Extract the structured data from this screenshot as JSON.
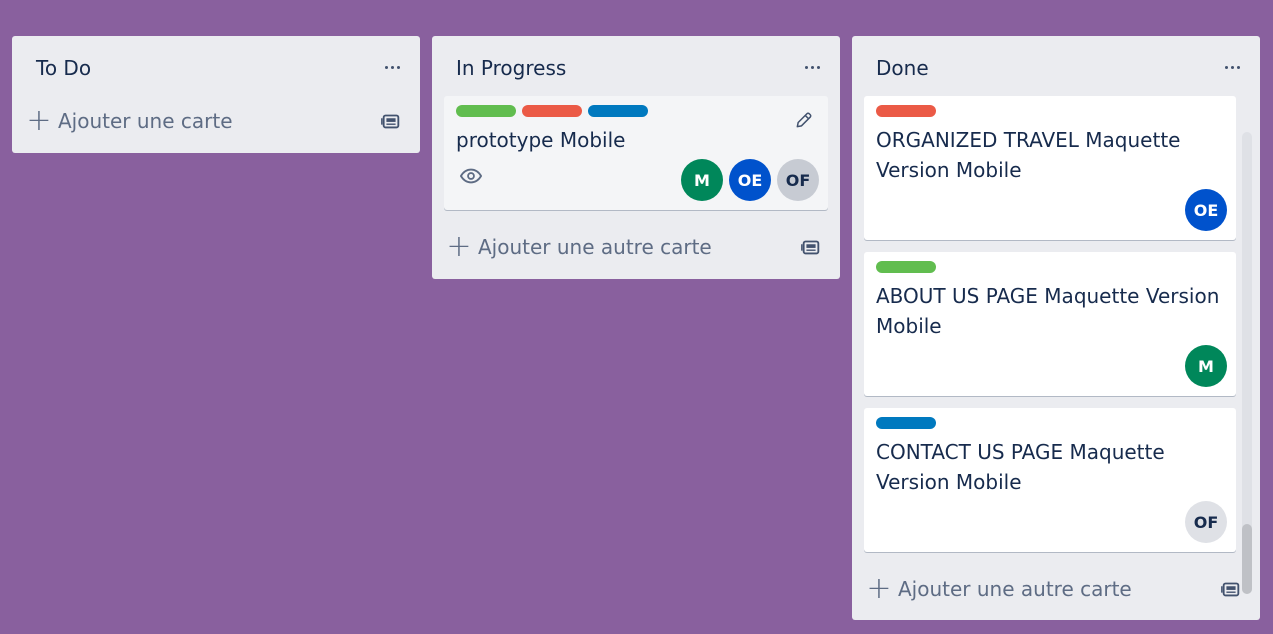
{
  "colors": {
    "board_bg": "#89609e",
    "label_green": "#61bd4f",
    "label_red": "#eb5a46",
    "label_blue": "#0079bf",
    "avatar_m": "#00875a",
    "avatar_oe": "#0052cc",
    "avatar_of": "#dfe1e6"
  },
  "lists": [
    {
      "title": "To Do",
      "add_label": "Ajouter une carte"
    },
    {
      "title": "In Progress",
      "cards": [
        {
          "labels": [
            "green",
            "red",
            "blue"
          ],
          "title": "prototype Mobile",
          "has_watch_icon": true,
          "members": [
            "M",
            "OE",
            "OF"
          ]
        }
      ],
      "add_label": "Ajouter une autre carte"
    },
    {
      "title": "Done",
      "cards": [
        {
          "labels": [
            "red"
          ],
          "title": "ORGANIZED TRAVEL Maquette Version Mobile",
          "members": [
            "OE"
          ]
        },
        {
          "labels": [
            "green"
          ],
          "title": "ABOUT US PAGE Maquette Version Mobile",
          "members": [
            "M"
          ]
        },
        {
          "labels": [
            "blue"
          ],
          "title": "CONTACT US PAGE Maquette Version Mobile",
          "members": [
            "OF"
          ]
        }
      ],
      "add_label": "Ajouter une autre carte"
    }
  ],
  "icons": {
    "list_menu": "more-horizontal-icon",
    "add": "plus-icon",
    "template": "card-template-icon",
    "edit": "pencil-icon",
    "watch": "eye-icon"
  }
}
